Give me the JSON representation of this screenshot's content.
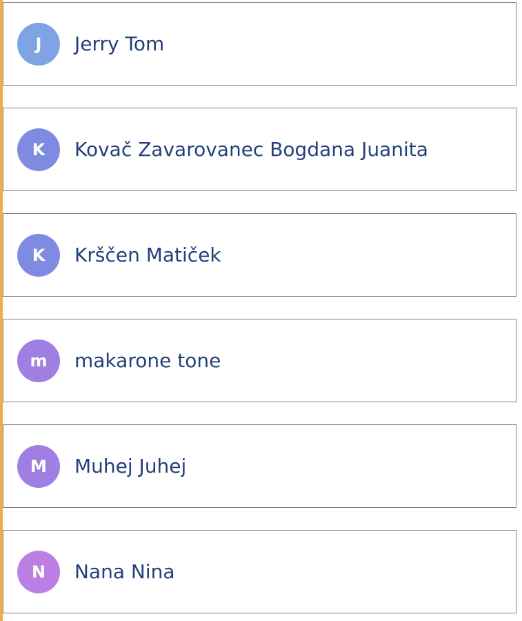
{
  "contacts": [
    {
      "initial": "J",
      "name": "Jerry Tom",
      "avatar_color": "#7fa3e3"
    },
    {
      "initial": "K",
      "name": "Kovač Zavarovanec Bogdana Juanita",
      "avatar_color": "#7f8be3"
    },
    {
      "initial": "K",
      "name": "Krščen Matiček",
      "avatar_color": "#7f8be3"
    },
    {
      "initial": "m",
      "name": "makarone tone",
      "avatar_color": "#a07fe3"
    },
    {
      "initial": "M",
      "name": "Muhej Juhej",
      "avatar_color": "#a07fe3"
    },
    {
      "initial": "N",
      "name": "Nana Nina",
      "avatar_color": "#bb7fe3"
    }
  ],
  "colors": {
    "accent_bar": "#f0ad4e",
    "name_text": "#23407a",
    "card_border": "#7f7f7f"
  }
}
